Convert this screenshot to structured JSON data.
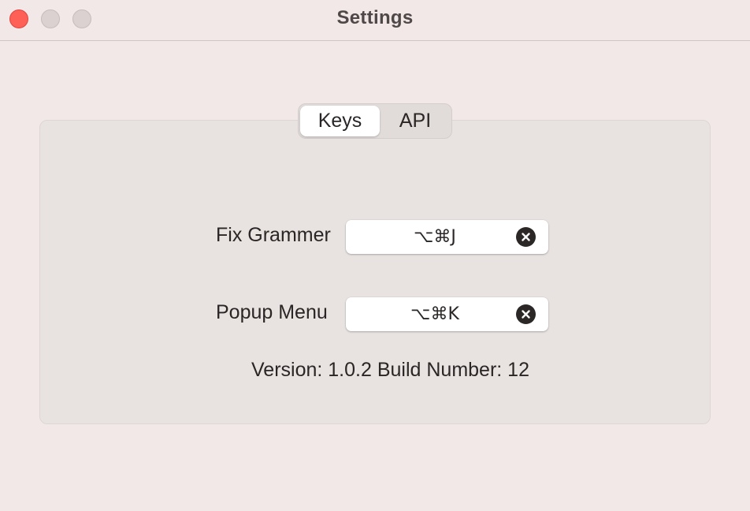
{
  "window": {
    "title": "Settings"
  },
  "tabs": [
    {
      "label": "Keys",
      "selected": true
    },
    {
      "label": "API",
      "selected": false
    }
  ],
  "shortcuts": [
    {
      "label": "Fix Grammer",
      "value": "⌥⌘J"
    },
    {
      "label": "Popup Menu",
      "value": "⌥⌘K"
    }
  ],
  "version_text": "Version: 1.0.2 Build Number: 12",
  "colors": {
    "close": "#fe5f57",
    "background": "#f2e8e7",
    "panel": "#e8e3e1"
  },
  "icons": {
    "close": "close-window-icon",
    "minimize": "minimize-window-icon",
    "zoom": "zoom-window-icon",
    "clear": "clear-shortcut-icon"
  }
}
